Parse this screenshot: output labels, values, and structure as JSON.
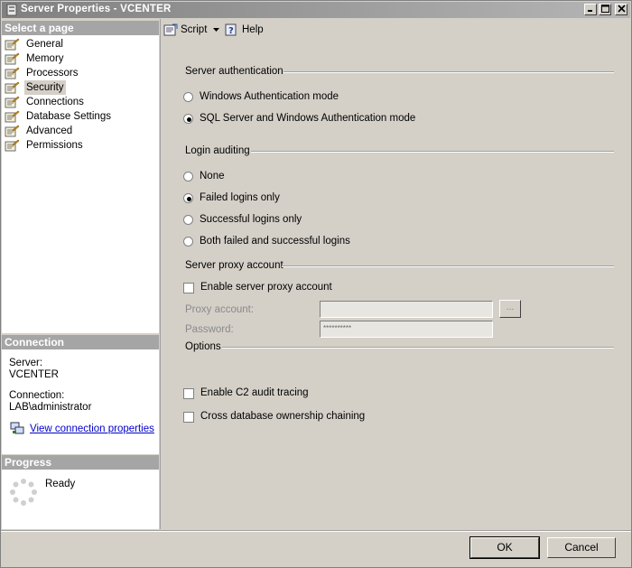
{
  "window": {
    "title": "Server Properties - VCENTER"
  },
  "left_panel": {
    "select_page_header": "Select a page",
    "pages": [
      {
        "label": "General"
      },
      {
        "label": "Memory"
      },
      {
        "label": "Processors"
      },
      {
        "label": "Security",
        "selected": true
      },
      {
        "label": "Connections"
      },
      {
        "label": "Database Settings"
      },
      {
        "label": "Advanced"
      },
      {
        "label": "Permissions"
      }
    ],
    "connection_header": "Connection",
    "server_label": "Server:",
    "server_value": "VCENTER",
    "connection_label": "Connection:",
    "connection_value": "LAB\\administrator",
    "view_connection_link": "View connection properties",
    "progress_header": "Progress",
    "progress_status": "Ready"
  },
  "toolbar": {
    "script_label": "Script",
    "help_label": "Help"
  },
  "server_authentication": {
    "title": "Server authentication",
    "options": [
      {
        "label": "Windows Authentication mode",
        "checked": false
      },
      {
        "label": "SQL Server and Windows Authentication mode",
        "checked": true
      }
    ]
  },
  "login_auditing": {
    "title": "Login auditing",
    "options": [
      {
        "label": "None",
        "checked": false
      },
      {
        "label": "Failed logins only",
        "checked": true
      },
      {
        "label": "Successful logins only",
        "checked": false
      },
      {
        "label": "Both failed and successful logins",
        "checked": false
      }
    ]
  },
  "server_proxy": {
    "title": "Server proxy account",
    "enable_label": "Enable server proxy account",
    "enable_checked": false,
    "proxy_account_label": "Proxy account:",
    "proxy_account_value": "",
    "browse_label": "...",
    "password_label": "Password:",
    "password_value": "**********"
  },
  "options": {
    "title": "Options",
    "c2_audit_label": "Enable C2 audit tracing",
    "c2_audit_checked": false,
    "cross_db_label": "Cross database ownership chaining",
    "cross_db_checked": false
  },
  "buttons": {
    "ok_label": "OK",
    "cancel_label": "Cancel"
  },
  "colors": {
    "panel_header": "#a5a5a5",
    "dialog_bg": "#d4d0c8",
    "link": "#0000cc"
  }
}
